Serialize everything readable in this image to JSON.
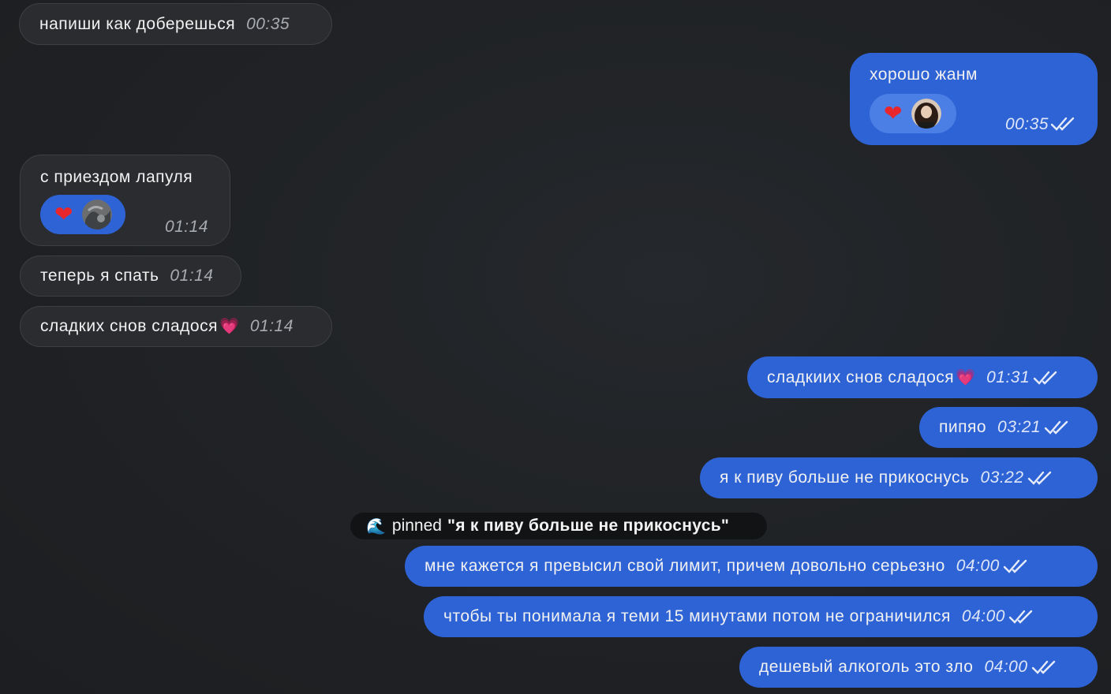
{
  "messages": [
    {
      "text": "напиши как доберешься",
      "time": "00:35"
    },
    {
      "text": "хорошо жанм",
      "time": "00:35"
    },
    {
      "text": "с приездом лапуля",
      "time": "01:14"
    },
    {
      "text": "теперь я спать",
      "time": "01:14"
    },
    {
      "text": "сладких снов сладося",
      "time": "01:14"
    },
    {
      "text": "сладкиих снов сладося",
      "time": "01:31"
    },
    {
      "text": "пипяо",
      "time": "03:21"
    },
    {
      "text": "я к пиву больше не прикоснусь",
      "time": "03:22"
    },
    {
      "text": "мне кажется я превысил свой лимит, причем довольно серьезно",
      "time": "04:00"
    },
    {
      "text": "чтобы ты понимала я теми 15 минутами потом не ограничился",
      "time": "04:00"
    },
    {
      "text": "дешевый алкоголь это зло",
      "time": "04:00"
    }
  ],
  "pinned": {
    "label": "pinned",
    "quote": "\"я к пиву больше не прикоснусь\""
  },
  "colors": {
    "background": "#1f2124",
    "incoming_bubble": "#2a2c2f",
    "outgoing_bubble": "#2e63d6",
    "reaction_heart": "#e8262b"
  },
  "icons": {
    "read_ticks": "double-check-icon",
    "reaction": "heart-icon",
    "pinned_emoji": "wave-icon",
    "message_emoji": "sparkling-heart-icon"
  }
}
